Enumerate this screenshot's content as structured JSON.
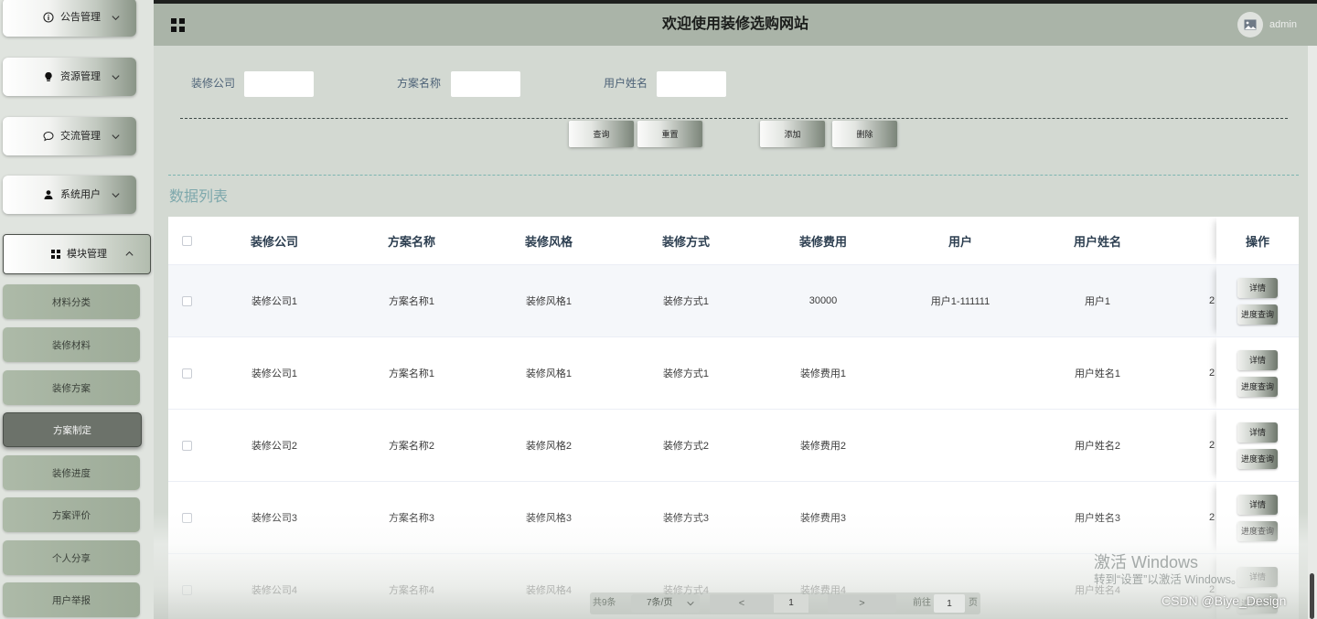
{
  "header": {
    "title": "欢迎使用装修选购网站",
    "username": "admin",
    "menu_icon": "grid-icon",
    "avatar_icon": "image-icon"
  },
  "sidebar": {
    "menus": [
      {
        "label": "公告管理",
        "icon": "info-icon",
        "expanded": false
      },
      {
        "label": "资源管理",
        "icon": "lightbulb-icon",
        "expanded": false
      },
      {
        "label": "交流管理",
        "icon": "chat-icon",
        "expanded": false
      },
      {
        "label": "系统用户",
        "icon": "user-icon",
        "expanded": false
      },
      {
        "label": "模块管理",
        "icon": "grid-icon",
        "expanded": true
      }
    ],
    "submenu": [
      {
        "label": "材料分类",
        "active": false
      },
      {
        "label": "装修材料",
        "active": false
      },
      {
        "label": "装修方案",
        "active": false
      },
      {
        "label": "方案制定",
        "active": true
      },
      {
        "label": "装修进度",
        "active": false
      },
      {
        "label": "方案评价",
        "active": false
      },
      {
        "label": "个人分享",
        "active": false
      },
      {
        "label": "用户举报",
        "active": false
      }
    ]
  },
  "search": {
    "fields": [
      {
        "label": "装修公司",
        "value": ""
      },
      {
        "label": "方案名称",
        "value": ""
      },
      {
        "label": "用户姓名",
        "value": ""
      }
    ],
    "buttons": {
      "query": "查询",
      "reset": "重置",
      "add": "添加",
      "delete": "删除"
    }
  },
  "list_title": "数据列表",
  "table": {
    "columns": [
      "装修公司",
      "方案名称",
      "装修风格",
      "装修方式",
      "装修费用",
      "用户",
      "用户姓名",
      "",
      "操作"
    ],
    "rows": [
      {
        "cells": [
          "装修公司1",
          "方案名称1",
          "装修风格1",
          "装修方式1",
          "30000",
          "用户1-111111",
          "用户1",
          "2"
        ],
        "hovered": true
      },
      {
        "cells": [
          "装修公司1",
          "方案名称1",
          "装修风格1",
          "装修方式1",
          "装修费用1",
          "",
          "用户姓名1",
          "2"
        ],
        "hovered": false
      },
      {
        "cells": [
          "装修公司2",
          "方案名称2",
          "装修风格2",
          "装修方式2",
          "装修费用2",
          "",
          "用户姓名2",
          "2"
        ],
        "hovered": false
      },
      {
        "cells": [
          "装修公司3",
          "方案名称3",
          "装修风格3",
          "装修方式3",
          "装修费用3",
          "",
          "用户姓名3",
          "2"
        ],
        "hovered": false
      },
      {
        "cells": [
          "装修公司4",
          "方案名称4",
          "装修风格4",
          "装修方式4",
          "装修费用4",
          "",
          "用户姓名4",
          "2"
        ],
        "hovered": false
      }
    ],
    "actions": [
      "详情",
      "进度查询"
    ]
  },
  "pagination": {
    "total": "共9条",
    "page_size": "7条/页",
    "prev": "<",
    "current_page": "1",
    "next": ">",
    "goto_label": "前往",
    "goto_value": "1",
    "page_unit": "页"
  },
  "os_watermark": {
    "title": "激活 Windows",
    "subtitle": "转到“设置”以激活 Windows。"
  },
  "credit": "CSDN @Biye_Design",
  "theme": {
    "header_bg": "#aab4a8",
    "page_bg": "#d3d9d2",
    "submenu_bg": "#a5b2a0",
    "active_menu_bg": "#6c726a",
    "list_title_color": "#7ea8ac",
    "hover_row_bg": "#f5f7fa"
  }
}
